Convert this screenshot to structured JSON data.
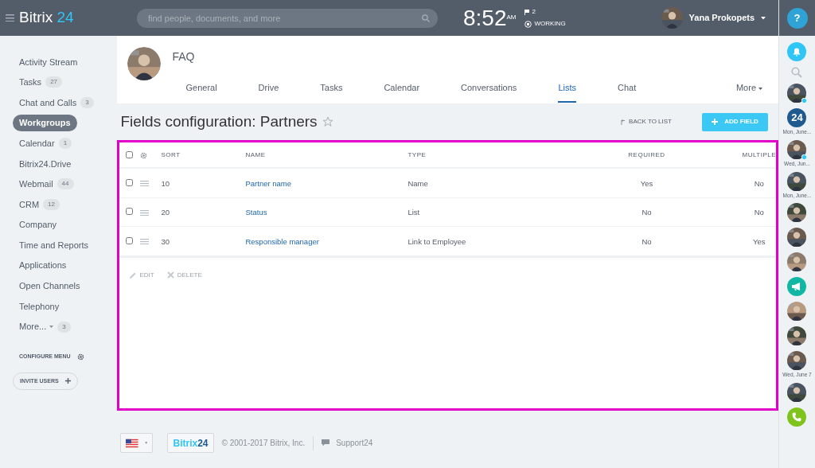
{
  "header": {
    "logo": "Bitrix",
    "logo_accent": "24",
    "search": {
      "placeholder": "find people, documents, and more"
    },
    "time": "8:52",
    "ampm": "AM",
    "flag_count": "2",
    "work_status": "WORKING",
    "user_name": "Yana Prokopets"
  },
  "sidebar": {
    "items": [
      {
        "label": "Activity Stream",
        "selected": false
      },
      {
        "label": "Tasks",
        "count": "27",
        "selected": false
      },
      {
        "label": "Chat and Calls",
        "count": "3",
        "selected": false
      },
      {
        "label": "Workgroups",
        "selected": true
      },
      {
        "label": "Calendar",
        "count": "1",
        "selected": false
      },
      {
        "label": "Bitrix24.Drive",
        "selected": false
      },
      {
        "label": "Webmail",
        "count": "44",
        "selected": false
      },
      {
        "label": "CRM",
        "count": "12",
        "selected": false
      },
      {
        "label": "Company",
        "selected": false
      },
      {
        "label": "Time and Reports",
        "selected": false
      },
      {
        "label": "Applications",
        "selected": false
      },
      {
        "label": "Open Channels",
        "selected": false
      },
      {
        "label": "Telephony",
        "selected": false
      },
      {
        "label": "More...",
        "count": "3",
        "dropdown": true,
        "selected": false
      }
    ],
    "configure": "CONFIGURE MENU",
    "invite": "INVITE USERS"
  },
  "group": {
    "title": "FAQ",
    "tabs": [
      {
        "label": "General",
        "selected": false
      },
      {
        "label": "Drive",
        "selected": false
      },
      {
        "label": "Tasks",
        "selected": false
      },
      {
        "label": "Calendar",
        "selected": false
      },
      {
        "label": "Conversations",
        "selected": false
      },
      {
        "label": "Lists",
        "selected": true
      },
      {
        "label": "Chat",
        "selected": false
      },
      {
        "label": "More",
        "dropdown": true,
        "selected": false
      }
    ]
  },
  "page": {
    "title": "Fields configuration: Partners",
    "back": "BACK TO LIST",
    "add": "ADD FIELD"
  },
  "table": {
    "columns": [
      "SORT",
      "NAME",
      "TYPE",
      "REQUIRED",
      "MULTIPLE"
    ],
    "all_checked": false,
    "rows": [
      {
        "sort": "10",
        "name": "Partner name",
        "type": "Name",
        "required": "Yes",
        "multiple": "No",
        "checked": false
      },
      {
        "sort": "20",
        "name": "Status",
        "type": "List",
        "required": "No",
        "multiple": "No",
        "checked": false
      },
      {
        "sort": "30",
        "name": "Responsible manager",
        "type": "Link to Employee",
        "required": "No",
        "multiple": "Yes",
        "checked": false
      }
    ],
    "actions": [
      "EDIT",
      "DELETE"
    ]
  },
  "footer": {
    "logo": "Bitrix",
    "logo_accent": "24",
    "copyright": "© 2001-2017 Bitrix, Inc.",
    "support": "Support24"
  },
  "right_bar": {
    "help": "?",
    "items": [
      {
        "kind": "bell"
      },
      {
        "kind": "search"
      },
      {
        "kind": "avatar",
        "online": true
      },
      {
        "kind": "badge",
        "text": "24"
      },
      {
        "kind": "date",
        "text": "Mon, June..."
      },
      {
        "kind": "avatar",
        "online": true
      },
      {
        "kind": "date",
        "text": "Wed, Jun..."
      },
      {
        "kind": "avatar",
        "online": false
      },
      {
        "kind": "date",
        "text": "Mon, June..."
      },
      {
        "kind": "avatar",
        "online": false
      },
      {
        "kind": "avatar",
        "online": false
      },
      {
        "kind": "avatar",
        "online": false
      },
      {
        "kind": "megaphone"
      },
      {
        "kind": "avatar",
        "online": false
      },
      {
        "kind": "avatar",
        "online": false
      },
      {
        "kind": "avatar",
        "online": false
      },
      {
        "kind": "date",
        "text": "Wed, June 7"
      },
      {
        "kind": "avatar",
        "online": false
      },
      {
        "kind": "phone"
      }
    ]
  }
}
